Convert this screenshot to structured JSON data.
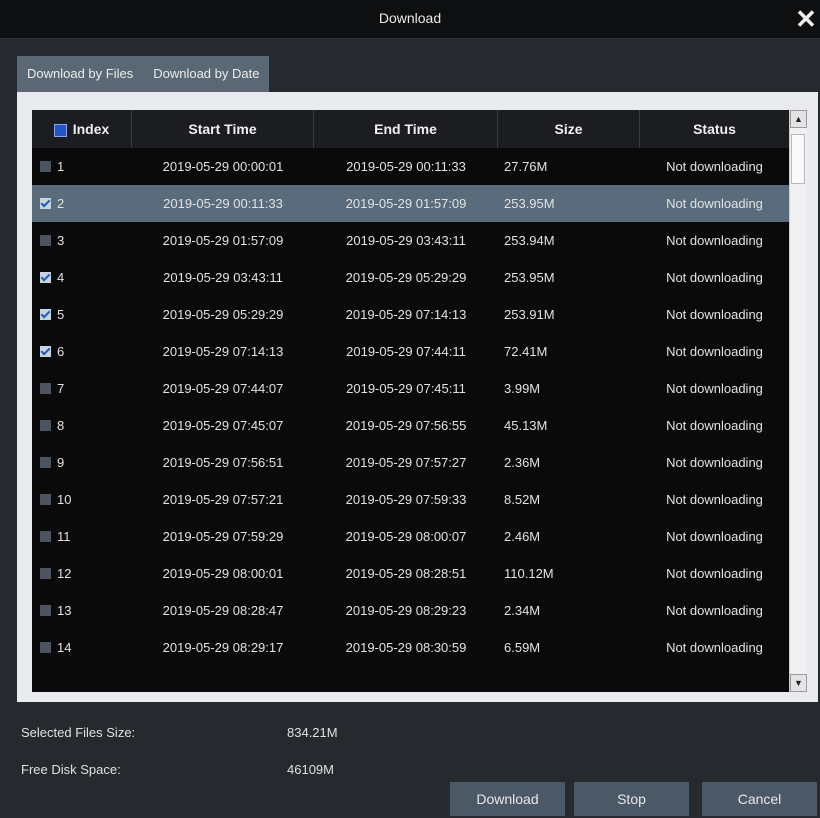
{
  "window": {
    "title": "Download",
    "close_glyph": "✕"
  },
  "tabs": [
    {
      "label": "Download by Files",
      "active": true
    },
    {
      "label": "Download by Date",
      "active": false
    }
  ],
  "table": {
    "columns": [
      "Index",
      "Start Time",
      "End Time",
      "Size",
      "Status"
    ],
    "rows": [
      {
        "index": "1",
        "checked": false,
        "start": "2019-05-29 00:00:01",
        "end": "2019-05-29 00:11:33",
        "size": "27.76M",
        "status": "Not downloading"
      },
      {
        "index": "2",
        "checked": true,
        "start": "2019-05-29 00:11:33",
        "end": "2019-05-29 01:57:09",
        "size": "253.95M",
        "status": "Not downloading"
      },
      {
        "index": "3",
        "checked": false,
        "start": "2019-05-29 01:57:09",
        "end": "2019-05-29 03:43:11",
        "size": "253.94M",
        "status": "Not downloading"
      },
      {
        "index": "4",
        "checked": true,
        "start": "2019-05-29 03:43:11",
        "end": "2019-05-29 05:29:29",
        "size": "253.95M",
        "status": "Not downloading"
      },
      {
        "index": "5",
        "checked": true,
        "start": "2019-05-29 05:29:29",
        "end": "2019-05-29 07:14:13",
        "size": "253.91M",
        "status": "Not downloading"
      },
      {
        "index": "6",
        "checked": true,
        "start": "2019-05-29 07:14:13",
        "end": "2019-05-29 07:44:11",
        "size": "72.41M",
        "status": "Not downloading"
      },
      {
        "index": "7",
        "checked": false,
        "start": "2019-05-29 07:44:07",
        "end": "2019-05-29 07:45:11",
        "size": "3.99M",
        "status": "Not downloading"
      },
      {
        "index": "8",
        "checked": false,
        "start": "2019-05-29 07:45:07",
        "end": "2019-05-29 07:56:55",
        "size": "45.13M",
        "status": "Not downloading"
      },
      {
        "index": "9",
        "checked": false,
        "start": "2019-05-29 07:56:51",
        "end": "2019-05-29 07:57:27",
        "size": "2.36M",
        "status": "Not downloading"
      },
      {
        "index": "10",
        "checked": false,
        "start": "2019-05-29 07:57:21",
        "end": "2019-05-29 07:59:33",
        "size": "8.52M",
        "status": "Not downloading"
      },
      {
        "index": "11",
        "checked": false,
        "start": "2019-05-29 07:59:29",
        "end": "2019-05-29 08:00:07",
        "size": "2.46M",
        "status": "Not downloading"
      },
      {
        "index": "12",
        "checked": false,
        "start": "2019-05-29 08:00:01",
        "end": "2019-05-29 08:28:51",
        "size": "110.12M",
        "status": "Not downloading"
      },
      {
        "index": "13",
        "checked": false,
        "start": "2019-05-29 08:28:47",
        "end": "2019-05-29 08:29:23",
        "size": "2.34M",
        "status": "Not downloading"
      },
      {
        "index": "14",
        "checked": false,
        "start": "2019-05-29 08:29:17",
        "end": "2019-05-29 08:30:59",
        "size": "6.59M",
        "status": "Not downloading"
      }
    ],
    "selected_row": 1
  },
  "summary": {
    "selected_label": "Selected Files Size:",
    "selected_value": "834.21M",
    "free_label": "Free Disk Space:",
    "free_value": "46109M"
  },
  "buttons": {
    "download": "Download",
    "stop": "Stop",
    "cancel": "Cancel"
  },
  "scrollbar": {
    "up_glyph": "▲",
    "down_glyph": "▼"
  }
}
